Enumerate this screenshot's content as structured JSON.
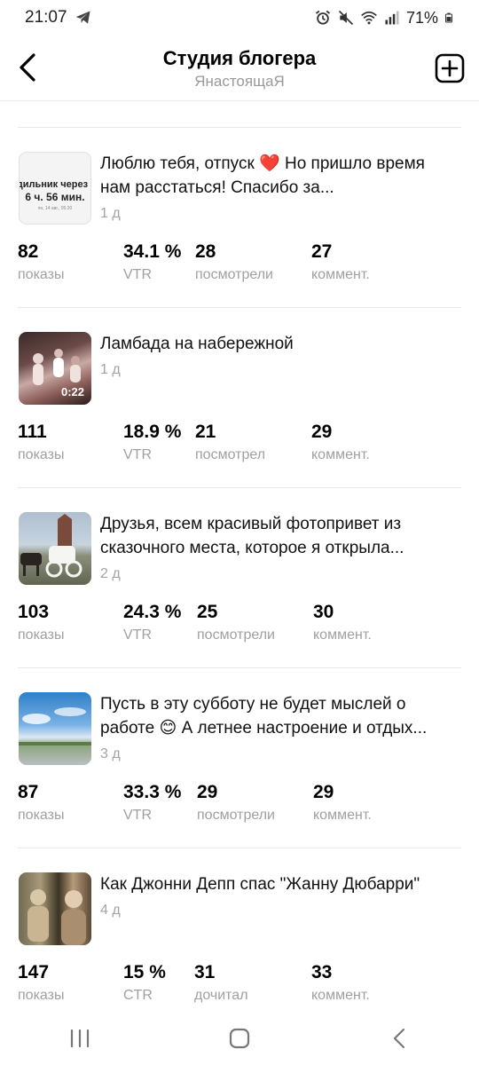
{
  "status_bar": {
    "time": "21:07",
    "battery": "71%"
  },
  "header": {
    "title": "Студия блогера",
    "subtitle": "ЯнастоящаЯ"
  },
  "posts": [
    {
      "title": "Люблю тебя, отпуск ❤️ Но пришло время нам расстаться! Спасибо за...",
      "age": "1 д",
      "thumb_lines": [
        "удильник через",
        "6 ч. 56 мин.",
        "пн, 14 авг., 05:20"
      ],
      "stats": [
        {
          "value": "82",
          "label": "показы"
        },
        {
          "value": "34.1 %",
          "label": "VTR"
        },
        {
          "value": "28",
          "label": "посмотрели"
        },
        {
          "value": "27",
          "label": "коммент."
        }
      ]
    },
    {
      "title": "Ламбада на набережной",
      "age": "1 д",
      "duration": "0:22",
      "stats": [
        {
          "value": "111",
          "label": "показы"
        },
        {
          "value": "18.9 %",
          "label": "VTR"
        },
        {
          "value": "21",
          "label": "посмотрел"
        },
        {
          "value": "29",
          "label": "коммент."
        }
      ]
    },
    {
      "title": "Друзья, всем красивый фотопривет из сказочного места, которое я открыла...",
      "age": "2 д",
      "stats": [
        {
          "value": "103",
          "label": "показы"
        },
        {
          "value": "24.3 %",
          "label": "VTR"
        },
        {
          "value": "25",
          "label": "посмотрели"
        },
        {
          "value": "30",
          "label": "коммент."
        }
      ]
    },
    {
      "title": "Пусть в эту субботу не будет мыслей о работе 😊 А летнее настроение и отдых...",
      "age": "3 д",
      "stats": [
        {
          "value": "87",
          "label": "показы"
        },
        {
          "value": "33.3 %",
          "label": "VTR"
        },
        {
          "value": "29",
          "label": "посмотрели"
        },
        {
          "value": "29",
          "label": "коммент."
        }
      ]
    },
    {
      "title": "Как Джонни Депп спас \"Жанну Дюбарри\"",
      "age": "4 д",
      "stats": [
        {
          "value": "147",
          "label": "показы"
        },
        {
          "value": "15 %",
          "label": "CTR"
        },
        {
          "value": "31",
          "label": "дочитал"
        },
        {
          "value": "33",
          "label": "коммент."
        }
      ]
    }
  ],
  "colors": {
    "heart": "#e0242b",
    "muted": "#a0a0a0",
    "divider": "#e8e8e8"
  },
  "icons": {
    "telegram": "telegram-icon",
    "alarm": "alarm-icon",
    "mute": "mute-icon",
    "wifi": "wifi-icon",
    "signal": "signal-icon",
    "battery": "battery-icon",
    "back": "back-arrow-icon",
    "add": "add-post-icon",
    "recents": "recents-icon",
    "home": "home-icon",
    "nav_back": "nav-back-icon"
  }
}
